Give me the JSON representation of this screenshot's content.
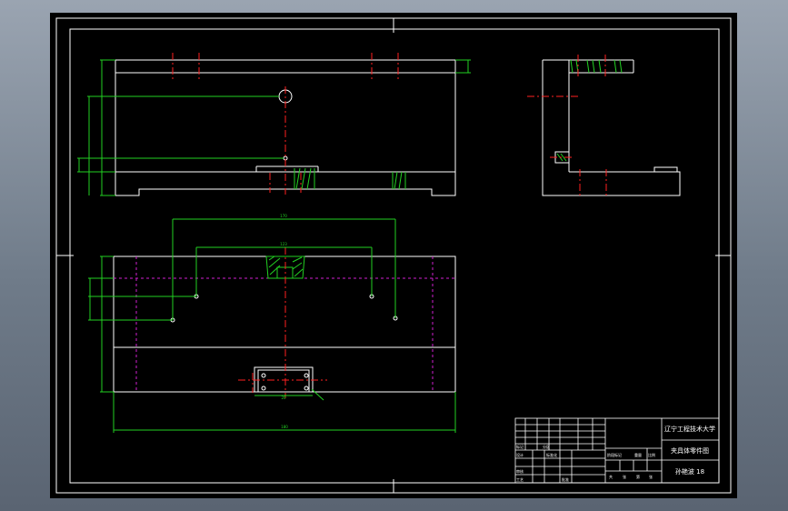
{
  "title_block": {
    "school": "辽宁工程技术大学",
    "drawing_name": "夹具体零件图",
    "student": "孙艳波 18",
    "row_labels": [
      "标记",
      "设计",
      "审核",
      "工艺"
    ],
    "mid_labels": [
      "分区",
      "标准化",
      "批准"
    ],
    "stage_labels": [
      "阶段标记",
      "重量",
      "比例"
    ],
    "sheet_labels": [
      "共",
      "张",
      "第",
      "张"
    ]
  },
  "dimensions": {
    "top_width": "170",
    "inner_width": "123",
    "overall_length": "180",
    "bottom_small": "20"
  },
  "colors": {
    "background": "#000000",
    "outline": "#ffffff",
    "centerline": "#ff2020",
    "dimension": "#22d022",
    "hatch": "#22d022",
    "hidden": "#d020d0",
    "app_frame": "#7c8794"
  }
}
